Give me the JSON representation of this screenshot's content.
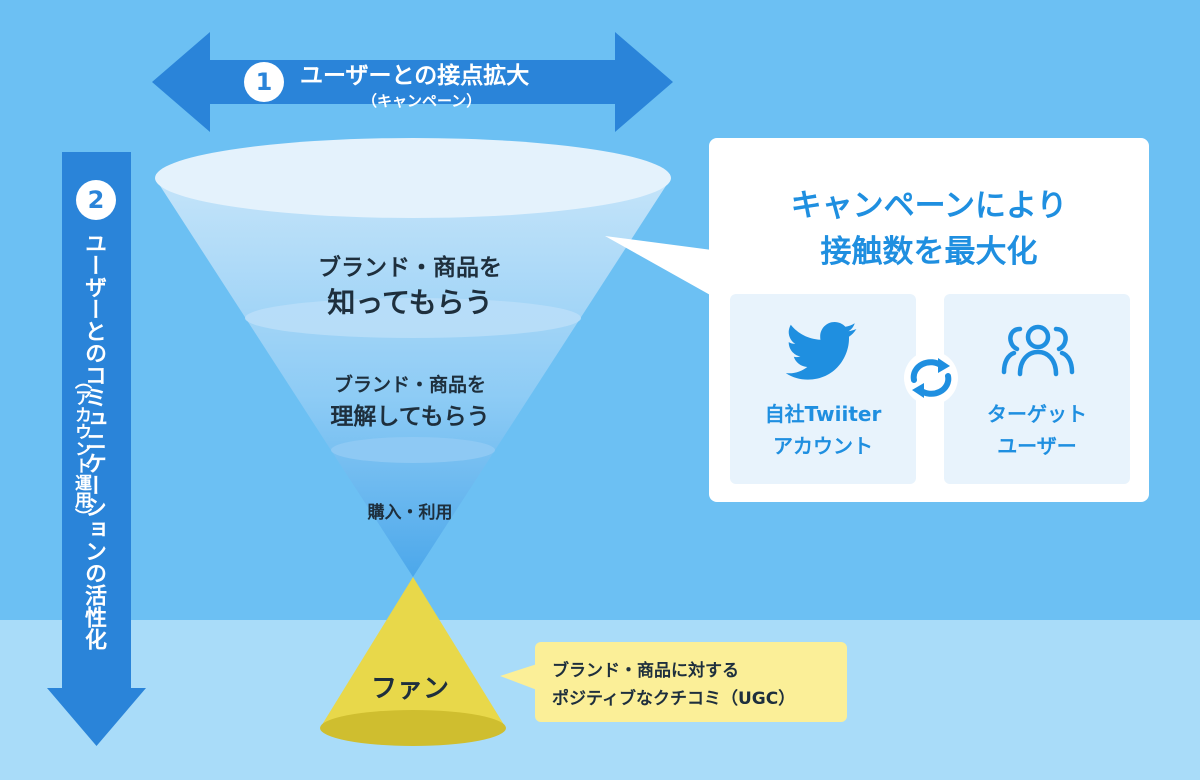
{
  "campaign_arrow": {
    "number": "1",
    "title": "ユーザーとの接点拡大",
    "subtitle": "（キャンペーン）"
  },
  "communication_arrow": {
    "number": "2",
    "title": "ユーザーとのコミュニケーションの活性化",
    "subtitle": "（アカウント運用）"
  },
  "funnel": {
    "top_line1": "ブランド・商品を",
    "top_line2": "知ってもらう",
    "mid_line1": "ブランド・商品を",
    "mid_line2": "理解してもらう",
    "bottom": "購入・利用",
    "fan": "ファン"
  },
  "callout": {
    "title_line1": "キャンペーンにより",
    "title_line2": "接触数を最大化",
    "left_card": {
      "icon": "twitter-bird-icon",
      "line1": "自社Twiiter",
      "line2": "アカウント"
    },
    "right_card": {
      "icon": "users-group-icon",
      "line1": "ターゲット",
      "line2": "ユーザー"
    },
    "cycle_icon": "cycle-arrows-icon"
  },
  "note": {
    "line1": "ブランド・商品に対する",
    "line2": "ポジティブなクチコミ（UGC）"
  },
  "colors": {
    "background": "#6cc0f3",
    "bottom_band": "#a9dcf9",
    "arrow_blue": "#2a84d9",
    "accent_blue": "#1f8fe0",
    "fan_yellow": "#e8d84a",
    "note_yellow": "#fbef98"
  }
}
